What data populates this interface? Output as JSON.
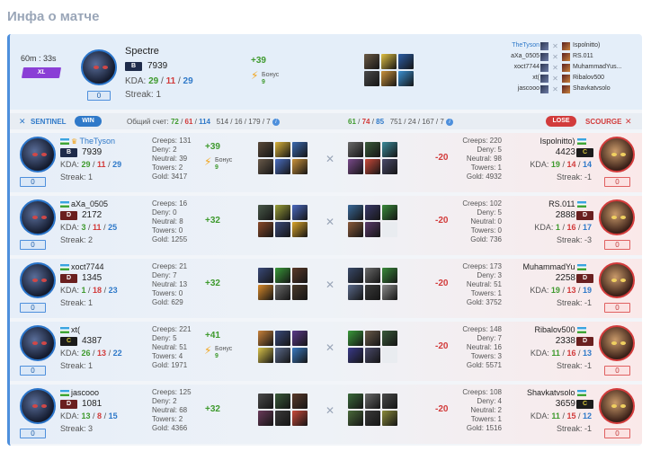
{
  "page": {
    "title": "Инфа о матче"
  },
  "summary": {
    "duration": "60m : 33s",
    "level_badge": "XL",
    "hero_name": "Spectre",
    "rank": "B",
    "mmr": "7939",
    "kda_label": "KDA:",
    "kills": "29",
    "deaths": "11",
    "assists": "29",
    "streak": "Streak: 1",
    "slot": "0",
    "delta": "+39",
    "bonus_label": "Бонус",
    "bonus_value": "9",
    "items": [
      "#6b5a45",
      "#e0c042",
      "#2c5fa8",
      "#4a4a4a",
      "#c9923a",
      "#3a8fd0"
    ],
    "matchups": [
      {
        "left": "TheTyson",
        "right": "Ispolnitto)",
        "left_highlight": true
      },
      {
        "left": "aXa_0505",
        "right": "RS.011",
        "left_highlight": false
      },
      {
        "left": "xoct7744",
        "right": "MuhammadYus...",
        "left_highlight": false
      },
      {
        "left": "xt(",
        "right": "Ribalov500",
        "left_highlight": false
      },
      {
        "left": "jascooo",
        "right": "Shavkatvsolo",
        "left_highlight": false
      }
    ]
  },
  "score_bar": {
    "sentinel_label": "SENTINEL",
    "win_label": "WIN",
    "total_label": "Общий счет:",
    "s_kills": "72",
    "s_deaths": "61",
    "s_assists": "114",
    "s_extra": "514 / 16 / 179 / 7",
    "sc_kills": "61",
    "sc_deaths": "74",
    "sc_assists": "85",
    "sc_extra": "751 / 24 / 167 / 7",
    "lose_label": "LOSE",
    "scourge_label": "SCOURGE"
  },
  "players": [
    {
      "left": {
        "name": "TheTyson",
        "rank": "B",
        "mmr": "7939",
        "k": "29",
        "d": "11",
        "a": "29",
        "streak": "Streak: 1",
        "slot": "0",
        "stats": "Creeps: 131\nDeny: 2\nNeutral: 39\nTowers: 2\nGold: 3417",
        "delta": "+39",
        "bonus": "9",
        "items": [
          "#5a4a3a",
          "#d8b23a",
          "#3a6ab0",
          "#6a5a4a",
          "#4a6ec0",
          "#c9923a"
        ]
      },
      "right": {
        "name": "Ispolnitto)",
        "rank": "C",
        "mmr": "4423",
        "k": "19",
        "d": "14",
        "a": "14",
        "streak": "Streak: -1",
        "slot": "0",
        "stats": "Creeps: 220\nDeny: 5\nNeutral: 98\nTowers: 1\nGold: 4932",
        "delta": "-20",
        "items": [
          "#6a6a6a",
          "#3a5a3a",
          "#3a8a9a",
          "#7a4a8a",
          "#c94a3a",
          "#4a4a6a"
        ]
      }
    },
    {
      "left": {
        "name": "aXa_0505",
        "rank": "D",
        "mmr": "2172",
        "k": "3",
        "d": "11",
        "a": "25",
        "streak": "Streak: 2",
        "slot": "0",
        "stats": "Creeps: 16\nDeny: 0\nNeutral: 8\nTowers: 0\nGold: 1255",
        "delta": "+32",
        "items": [
          "#4a5a4a",
          "#9aa03a",
          "#4a6ac0",
          "#8a4a2a",
          "#3a4a7a",
          "#d8a42a"
        ]
      },
      "right": {
        "name": "RS.011",
        "rank": "D",
        "mmr": "2888",
        "k": "1",
        "d": "16",
        "a": "17",
        "streak": "Streak: -3",
        "slot": "0",
        "stats": "Creeps: 102\nDeny: 5\nNeutral: 0\nTowers: 0\nGold: 736",
        "delta": "-20",
        "items": [
          "#3a6a9a",
          "#3a3a6a",
          "#3a8a3a",
          "#8a5a3a",
          "#5a3a6a",
          ""
        ]
      }
    },
    {
      "left": {
        "name": "xoct7744",
        "rank": "D",
        "mmr": "1345",
        "k": "1",
        "d": "18",
        "a": "23",
        "streak": "Streak: 1",
        "slot": "0",
        "stats": "Creeps: 21\nDeny: 7\nNeutral: 13\nTowers: 0\nGold: 629",
        "delta": "+32",
        "items": [
          "#3a4a7a",
          "#3a9a3a",
          "#5a3a2a",
          "#d88a2a",
          "#6a6a6a",
          "#4a3a2a"
        ]
      },
      "right": {
        "name": "MuhammadYu",
        "rank": "D",
        "mmr": "2258",
        "k": "19",
        "d": "13",
        "a": "19",
        "streak": "Streak: -1",
        "slot": "0",
        "stats": "Creeps: 173\nDeny: 3\nNeutral: 51\nTowers: 1\nGold: 3752",
        "delta": "-20",
        "items": [
          "#3a4a6a",
          "#6a6a6a",
          "#3a8a3a",
          "#5a6a8a",
          "#3a3a3a",
          "#8a8a8a"
        ]
      }
    },
    {
      "left": {
        "name": "xt(",
        "rank": "C",
        "mmr": "4387",
        "k": "26",
        "d": "13",
        "a": "22",
        "streak": "Streak: 1",
        "slot": "0",
        "stats": "Creeps: 221\nDeny: 5\nNeutral: 51\nTowers: 4\nGold: 1971",
        "delta": "+41",
        "bonus": "9",
        "items": [
          "#c9823a",
          "#3a4a7a",
          "#5a3a8a",
          "#d8c24a",
          "#5a6a8a",
          "#3a7ac0"
        ]
      },
      "right": {
        "name": "Ribalov500",
        "rank": "D",
        "mmr": "2338",
        "k": "11",
        "d": "16",
        "a": "13",
        "streak": "Streak: -1",
        "slot": "0",
        "stats": "Creeps: 148\nDeny: 7\nNeutral: 16\nTowers: 3\nGold: 5571",
        "delta": "-20",
        "items": [
          "#3a9a3a",
          "#6a5a4a",
          "#3a5a3a",
          "#3a3a8a",
          "#4a4a6a",
          ""
        ]
      }
    },
    {
      "left": {
        "name": "jascooo",
        "rank": "D",
        "mmr": "1081",
        "k": "13",
        "d": "8",
        "a": "15",
        "streak": "Streak: 3",
        "slot": "0",
        "stats": "Creeps: 125\nDeny: 2\nNeutral: 68\nTowers: 2\nGold: 4366",
        "delta": "+32",
        "items": [
          "#4a4a4a",
          "#3a5a3a",
          "#5a3a2a",
          "#6a3a5a",
          "#3a3a3a",
          "#c94a3a"
        ]
      },
      "right": {
        "name": "Shavkatvsolo",
        "rank": "C",
        "mmr": "3659",
        "k": "11",
        "d": "15",
        "a": "12",
        "streak": "Streak: -1",
        "slot": "0",
        "stats": "Creeps: 108\nDeny: 4\nNeutral: 2\nTowers: 1\nGold: 1516",
        "delta": "-20",
        "items": [
          "#3a6a3a",
          "#6a6a6a",
          "#4a4a4a",
          "#4a6a3a",
          "#3a3a3a",
          "#8a8a3a"
        ]
      }
    }
  ],
  "colors": {
    "accent": "#2f79c9",
    "win": "#3f9a2e",
    "lose": "#d23b3b",
    "level": "#8a3fd6"
  }
}
